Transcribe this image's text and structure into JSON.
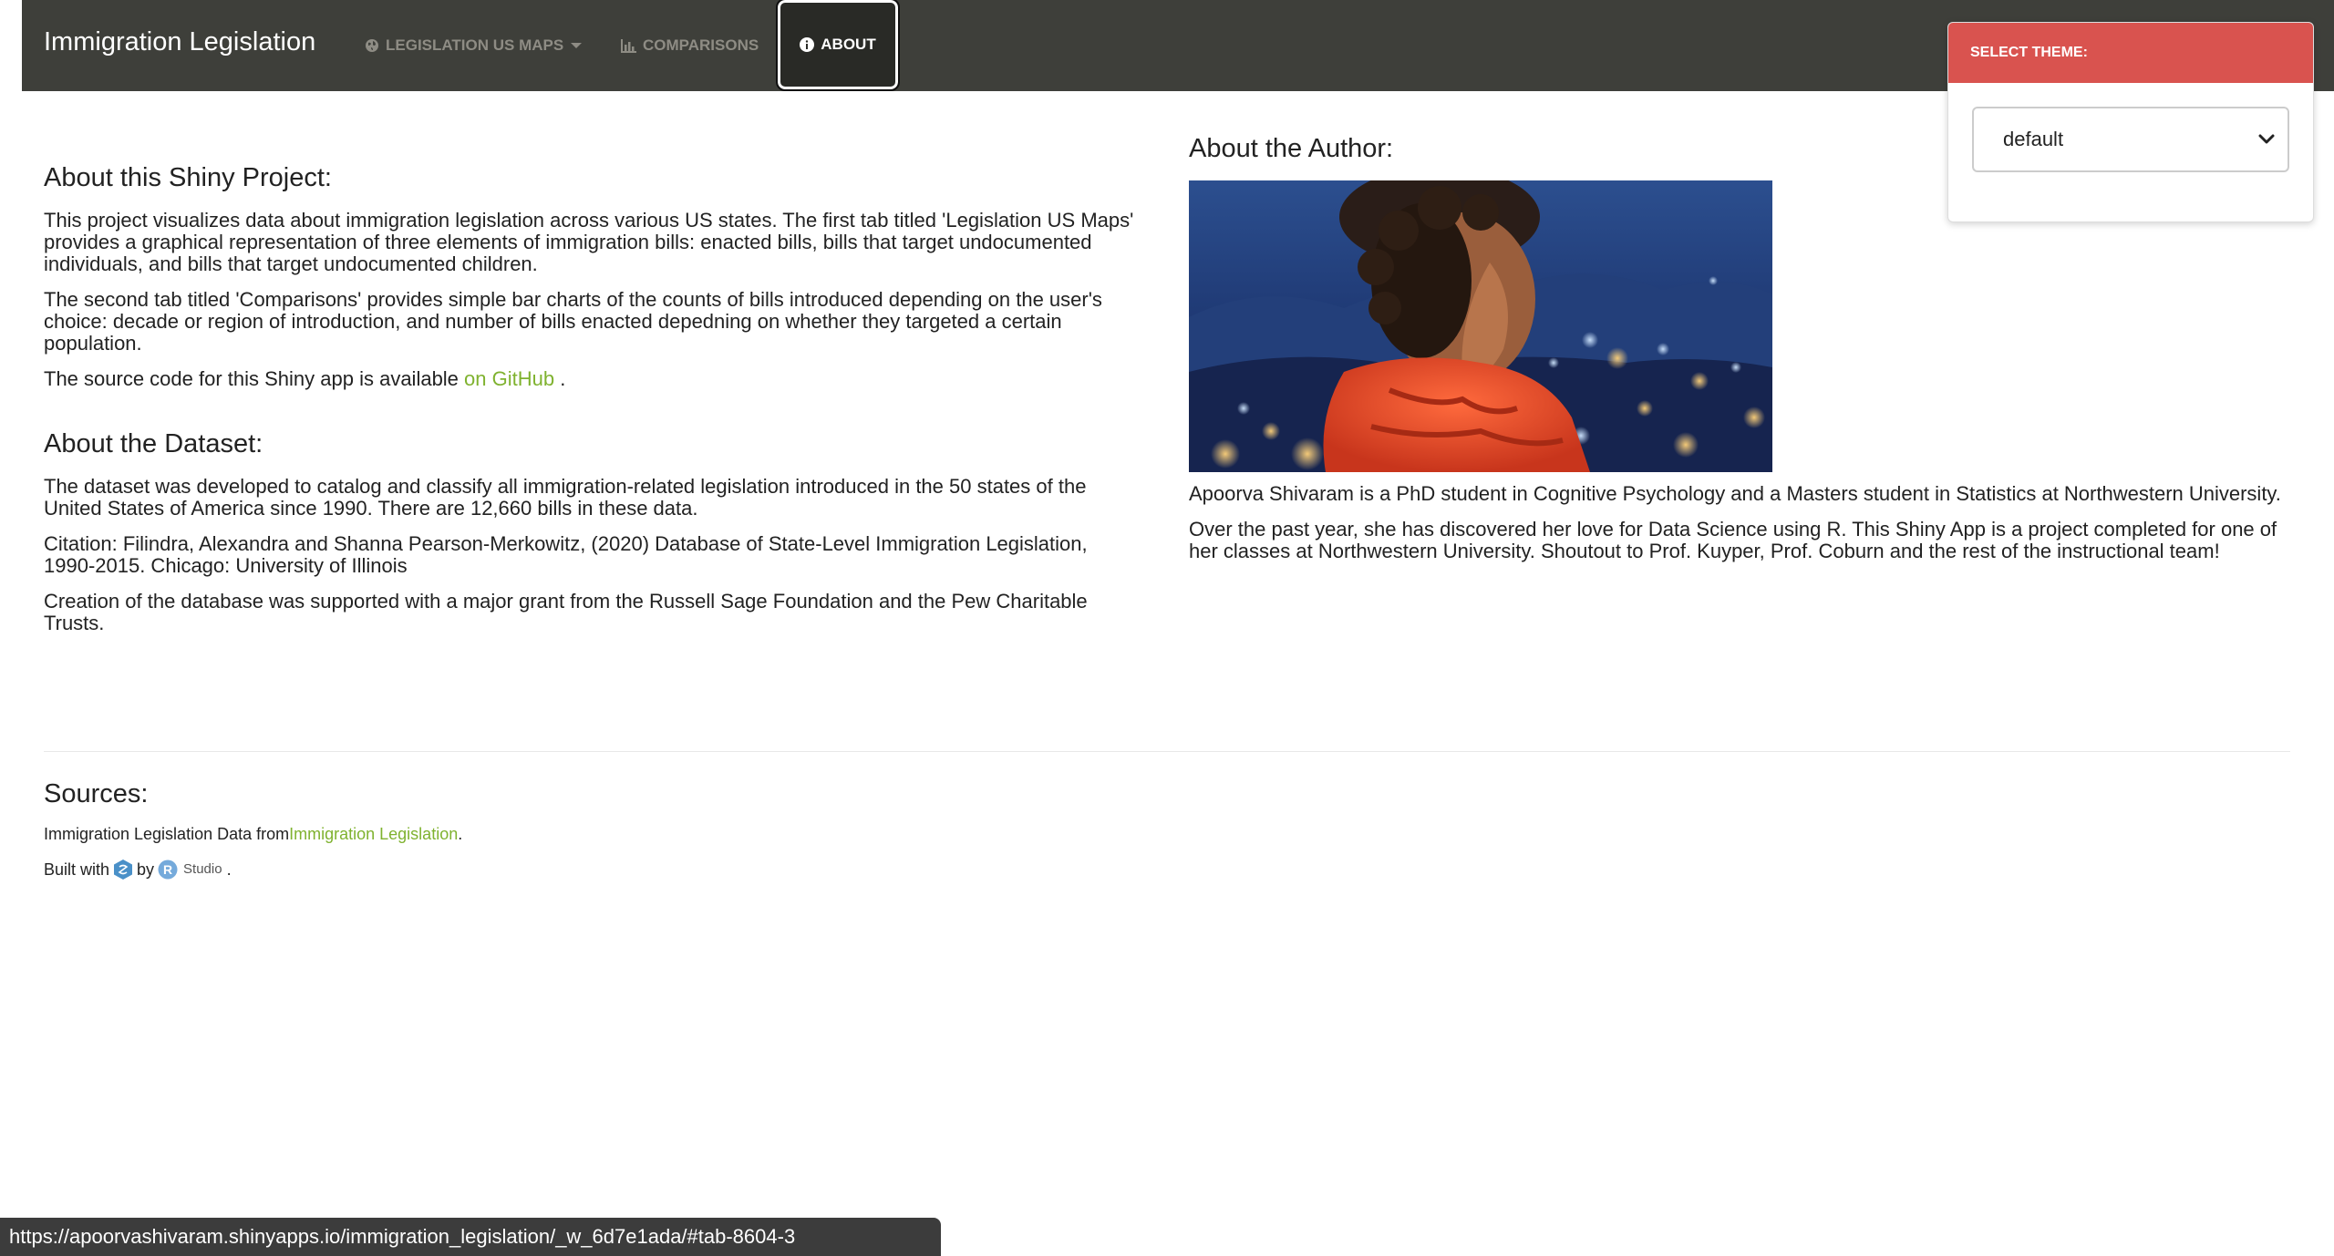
{
  "navbar": {
    "brand": "Immigration Legislation",
    "items": [
      {
        "label": "LEGISLATION US MAPS",
        "icon": "globe-icon",
        "dropdown": true
      },
      {
        "label": "COMPARISONS",
        "icon": "bar-chart-icon"
      },
      {
        "label": "ABOUT",
        "icon": "info-circle-icon",
        "active": true
      }
    ]
  },
  "project": {
    "heading": "About this Shiny Project:",
    "p1": "This project visualizes data about immigration legislation across various US states. The first tab titled 'Legislation US Maps' provides a graphical representation of three elements of immigration bills: enacted bills, bills that target undocumented individuals, and bills that target undocumented children.",
    "p2": "The second tab titled 'Comparisons' provides simple bar charts of the counts of bills introduced depending on the user's choice: decade or region of introduction, and number of bills enacted depedning on whether they targeted a certain population.",
    "p3_prefix": "The source code for this Shiny app is available ",
    "p3_link": "on GitHub",
    "p3_suffix": " ."
  },
  "dataset": {
    "heading": "About the Dataset:",
    "p1": "The dataset was developed to catalog and classify all immigration-related legislation introduced in the 50 states of the United States of America since 1990. There are 12,660 bills in these data.",
    "p2": "Citation: Filindra, Alexandra and Shanna Pearson-Merkowitz, (2020) Database of State-Level Immigration Legislation, 1990-2015. Chicago: University of Illinois",
    "p3": "Creation of the database was supported with a major grant from the Russell Sage Foundation and the Pew Charitable Trusts."
  },
  "author": {
    "heading": "About the Author:",
    "p1": "Apoorva Shivaram is a PhD student in Cognitive Psychology and a Masters student in Statistics at Northwestern University.",
    "p2": "Over the past year, she has discovered her love for Data Science using R. This Shiny App is a project completed for one of her classes at Northwestern University. Shoutout to Prof. Kuyper, Prof. Coburn and the rest of the instructional team!"
  },
  "sources": {
    "heading": "Sources:",
    "line1_prefix": "Immigration Legislation Data from ",
    "line1_link": "Immigration Legislation",
    "line1_suffix": " .",
    "built_prefix": "Built with",
    "built_by": "by",
    "rstudio_word": "Studio",
    "built_suffix": "."
  },
  "theme": {
    "title": "SELECT THEME:",
    "selected": "default"
  },
  "status_url": "https://apoorvashivaram.shinyapps.io/immigration_legislation/_w_6d7e1ada/#tab-8604-3",
  "colors": {
    "navbar": "#3e3f3a",
    "link": "#7fb22f",
    "theme_header": "#d9534f"
  }
}
